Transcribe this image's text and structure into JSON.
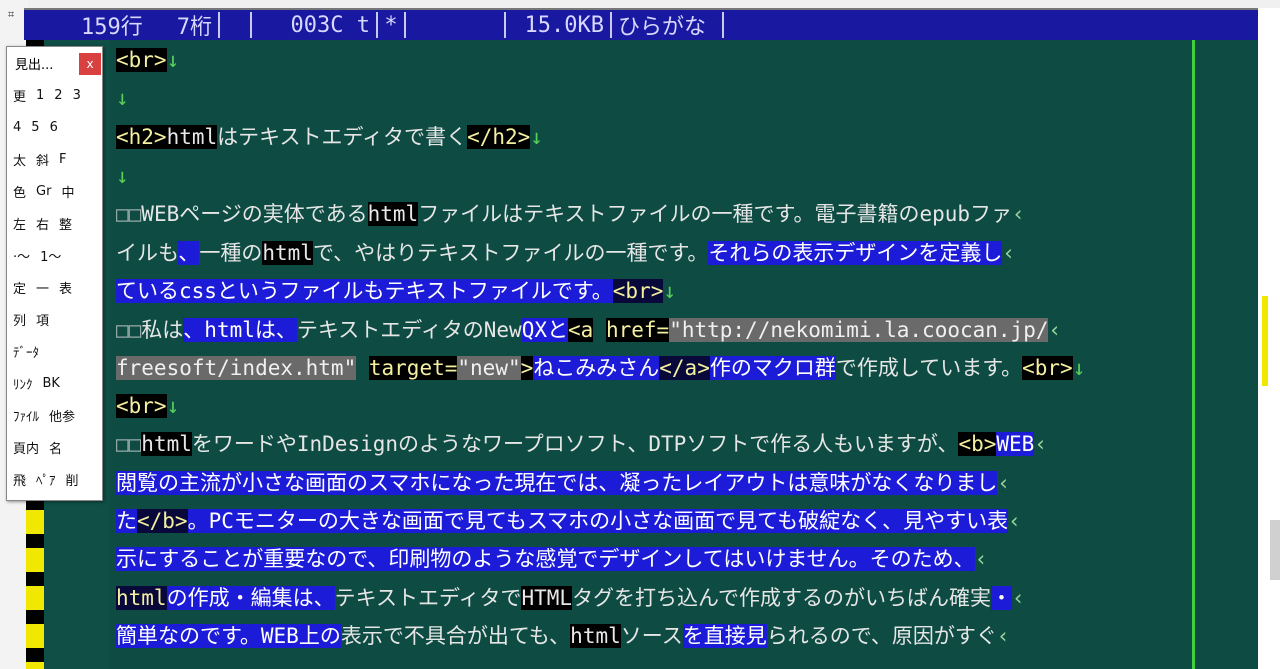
{
  "status": {
    "line": "159行",
    "col": "7桁",
    "code": "003C t",
    "modified": "*",
    "size": "15.0KB",
    "mode": "ひらがな"
  },
  "panel": {
    "title": "見出...",
    "close": "x",
    "rows": [
      [
        "更",
        "1",
        "2",
        "3"
      ],
      [
        "4",
        "5",
        "6"
      ],
      [
        "太",
        "斜",
        "F"
      ],
      [
        "色",
        "Gr",
        "中"
      ],
      [
        "左",
        "右",
        "整"
      ],
      [
        "·〜",
        "1〜"
      ],
      [
        "定",
        "一",
        "表"
      ],
      [
        "列",
        "項"
      ],
      [
        "ﾃﾞｰﾀ"
      ],
      [
        "ﾘﾝｸ",
        "BK"
      ],
      [
        "ﾌｧｲﾙ",
        "他参"
      ],
      [
        "頁内",
        "名"
      ],
      [
        "飛",
        "ﾍﾟｱ",
        "削"
      ]
    ]
  },
  "editor": {
    "nl": "↓",
    "cont": "‹",
    "sp": "□□",
    "l1_tag": "<br>",
    "l3_tag1": "<h2>",
    "l3_kw": "html",
    "l3_text": "はテキストエディタで書く",
    "l3_tag2": "</h2>",
    "l5_a": "WEBページの実体である",
    "l5_kw": "html",
    "l5_b": "ファイルはテキストファイルの一種です。電子書籍のepubファ",
    "l6_a": "イルも",
    "l6_b": "、",
    "l6_c": "一種の",
    "l6_kw": "html",
    "l6_d": "で、やはりテキストファイルの一種です。",
    "l6_sel": "それらの表示デザインを定義し",
    "l7_sel": "ているcssというファイルもテキストファイルです。",
    "l7_tag": "<br>",
    "l8_a": "私は",
    "l8_b": "、",
    "l8_kw": "html",
    "l8_c": "は、",
    "l8_d": "テキストエディタのNew",
    "l8_e": "QX",
    "l8_f": "と",
    "l8_tag": "<a",
    "l8_attr": "href=",
    "l8_url": "\"http://nekomimi.la.coocan.jp/",
    "l9_url": "freesoft/index.htm\"",
    "l9_attr": "target=",
    "l9_val": "\"new\"",
    "l9_tag1": ">",
    "l9_text": "ねこみみさん",
    "l9_tag2": "</a>",
    "l9_sel": "作のマクロ群",
    "l9_rest": "で作成しています。",
    "l9_tag3": "<br>",
    "l10_tag": "<br>",
    "l11_kw": "html",
    "l11_text": "をワードやInDesignのようなワープロソフト、DTPソフトで作る人もいますが、",
    "l11_tag": "<b>",
    "l11_sel": "WEB",
    "l12_sel": "閲覧の主流が小さな画面のスマホになった現在では、凝ったレイアウトは意味がなくなりまし",
    "l13_a": "た",
    "l13_tag": "</b>",
    "l13_sel": "。PCモニターの大きな画面で見てもスマホの小さな画面で見ても破綻なく、見やすい表",
    "l14_sel": "示にすることが重要なので、印刷物のような感覚でデザインしてはいけません。そのため、",
    "l15_kw": "html",
    "l15_sel": "の作成・編集は、",
    "l15_b": "テキストエディタで",
    "l15_kw2": "HTML",
    "l15_c": "タグを打ち込んで作成するのがいちばん確実",
    "l15_sel2": "・",
    "l16_sel": "簡単なのです。WEB上の",
    "l16_b": "表示で不具合が出ても、",
    "l16_kw": "html",
    "l16_c": "ソース",
    "l16_sel2": "を直接見",
    "l16_d": "られる",
    "l16_e": "ので、原因がすぐ"
  }
}
